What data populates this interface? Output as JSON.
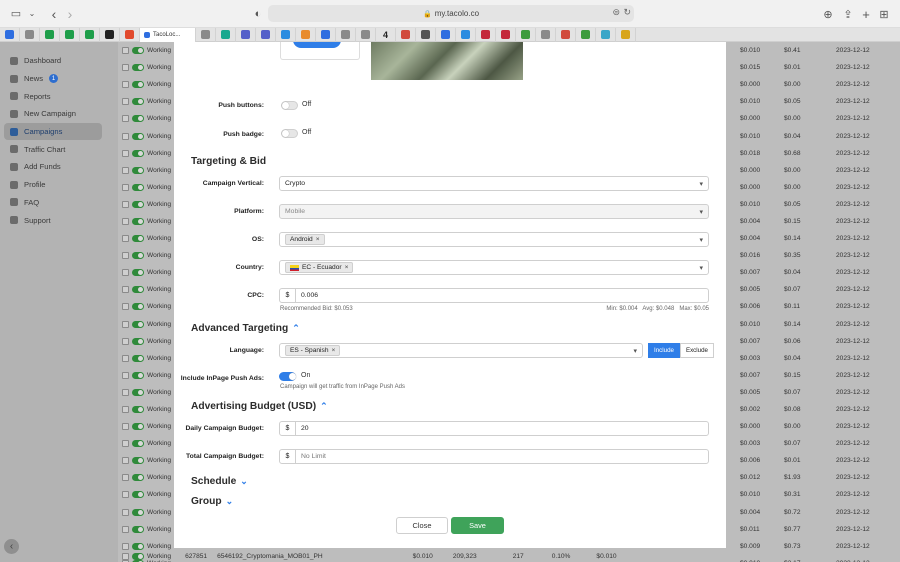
{
  "browser": {
    "url": "my.tacolo.co",
    "active_tab_label": "TacoLoc...",
    "tab_badge_number": "4",
    "favicon_colors": [
      "#2f6ee0",
      "#8a8a8a",
      "#1e9e4a",
      "#1e9e4a",
      "#1e9e4a",
      "#222",
      "#e14a2d",
      "#8a8a8a",
      "#1aa88f",
      "#5560c9",
      "#5560c9",
      "#2b8ce0",
      "#e88b2d",
      "#2f6ee0",
      "#8a8a8a",
      "#8a8a8a",
      "#d14b3c",
      "#555",
      "#2f6ee0",
      "#2b8ce0",
      "#c4283a",
      "#c4283a",
      "#3c9b3c",
      "#8a8a8a",
      "#d14b3c",
      "#3c9b3c",
      "#3aa6c8",
      "#d8a51b",
      "#2f6ee0"
    ]
  },
  "sidebar": {
    "items": [
      {
        "label": "Dashboard"
      },
      {
        "label": "News",
        "badge": "1"
      },
      {
        "label": "Reports"
      },
      {
        "label": "New Campaign"
      },
      {
        "label": "Campaigns",
        "active": true
      },
      {
        "label": "Traffic Chart"
      },
      {
        "label": "Add Funds"
      },
      {
        "label": "Profile"
      },
      {
        "label": "FAQ"
      },
      {
        "label": "Support"
      }
    ]
  },
  "table": {
    "status_text": "Working",
    "rows": [
      {
        "a": "$0.010",
        "b": "$0.41",
        "date": "2023-12-12"
      },
      {
        "a": "$0.015",
        "b": "$0.01",
        "date": "2023-12-12"
      },
      {
        "a": "$0.000",
        "b": "$0.00",
        "date": "2023-12-12"
      },
      {
        "a": "$0.010",
        "b": "$0.05",
        "date": "2023-12-12"
      },
      {
        "a": "$0.000",
        "b": "$0.00",
        "date": "2023-12-12"
      },
      {
        "a": "$0.010",
        "b": "$0.04",
        "date": "2023-12-12"
      },
      {
        "a": "$0.018",
        "b": "$0.68",
        "date": "2023-12-12"
      },
      {
        "a": "$0.000",
        "b": "$0.00",
        "date": "2023-12-12"
      },
      {
        "a": "$0.000",
        "b": "$0.00",
        "date": "2023-12-12"
      },
      {
        "a": "$0.010",
        "b": "$0.05",
        "date": "2023-12-12"
      },
      {
        "a": "$0.004",
        "b": "$0.15",
        "date": "2023-12-12"
      },
      {
        "a": "$0.004",
        "b": "$0.14",
        "date": "2023-12-12"
      },
      {
        "a": "$0.016",
        "b": "$0.35",
        "date": "2023-12-12"
      },
      {
        "a": "$0.007",
        "b": "$0.04",
        "date": "2023-12-12"
      },
      {
        "a": "$0.005",
        "b": "$0.07",
        "date": "2023-12-12"
      },
      {
        "a": "$0.006",
        "b": "$0.11",
        "date": "2023-12-12"
      },
      {
        "a": "$0.010",
        "b": "$0.14",
        "date": "2023-12-12"
      },
      {
        "a": "$0.007",
        "b": "$0.06",
        "date": "2023-12-12"
      },
      {
        "a": "$0.003",
        "b": "$0.04",
        "date": "2023-12-12"
      },
      {
        "a": "$0.007",
        "b": "$0.15",
        "date": "2023-12-12"
      },
      {
        "a": "$0.005",
        "b": "$0.07",
        "date": "2023-12-12"
      },
      {
        "a": "$0.002",
        "b": "$0.08",
        "date": "2023-12-12"
      },
      {
        "a": "$0.000",
        "b": "$0.00",
        "date": "2023-12-12"
      },
      {
        "a": "$0.003",
        "b": "$0.07",
        "date": "2023-12-12"
      },
      {
        "a": "$0.006",
        "b": "$0.01",
        "date": "2023-12-12"
      },
      {
        "a": "$0.012",
        "b": "$1.93",
        "date": "2023-12-12"
      },
      {
        "a": "$0.010",
        "b": "$0.31",
        "date": "2023-12-12"
      },
      {
        "a": "$0.004",
        "b": "$0.72",
        "date": "2023-12-12"
      },
      {
        "a": "$0.011",
        "b": "$0.77",
        "date": "2023-12-12"
      },
      {
        "a": "$0.009",
        "b": "$0.73",
        "date": "2023-12-12"
      },
      {
        "a": "$0.010",
        "b": "$2.17",
        "date": "2023-12-12"
      }
    ],
    "bottom_row": {
      "id": "627851",
      "name": "6546192_Cryptomania_MOB01_PH",
      "bid": "$0.010",
      "impressions": "209,323",
      "clicks": "217",
      "ctr": "0.10%",
      "cpc": "$0.010"
    }
  },
  "modal": {
    "push_buttons": {
      "label": "Push buttons:",
      "state": "Off"
    },
    "push_badge": {
      "label": "Push badge:",
      "state": "Off"
    },
    "targeting_title": "Targeting & Bid",
    "vertical": {
      "label": "Campaign Vertical:",
      "value": "Crypto"
    },
    "platform": {
      "label": "Platform:",
      "value": "Mobile"
    },
    "os": {
      "label": "OS:",
      "chip": "Android"
    },
    "country": {
      "label": "Country:",
      "chip": "EC - Ecuador"
    },
    "cpc": {
      "label": "CPC:",
      "currency": "$",
      "value": "0.006",
      "recommended": "Recommended Bid: $0.053",
      "range": "Min: $0.004   Avg: $0.048   Max: $0.05"
    },
    "advanced_title": "Advanced Targeting",
    "language": {
      "label": "Language:",
      "chip": "ES - Spanish",
      "include": "Include",
      "exclude": "Exclude"
    },
    "inpage": {
      "label": "Include InPage Push Ads:",
      "state": "On",
      "hint": "Campaign will get traffic from InPage Push Ads"
    },
    "budget_title": "Advertising Budget (USD)",
    "daily": {
      "label": "Daily Campaign Budget:",
      "currency": "$",
      "value": "20"
    },
    "total": {
      "label": "Total Campaign Budget:",
      "currency": "$",
      "placeholder": "No Limit"
    },
    "schedule_title": "Schedule",
    "group_title": "Group",
    "close_label": "Close",
    "save_label": "Save"
  },
  "icons": {
    "remove": "×",
    "dropdown": "▾",
    "chevron_up": "⌃",
    "chevron_down": "⌄",
    "back": "‹",
    "forward": "›"
  }
}
